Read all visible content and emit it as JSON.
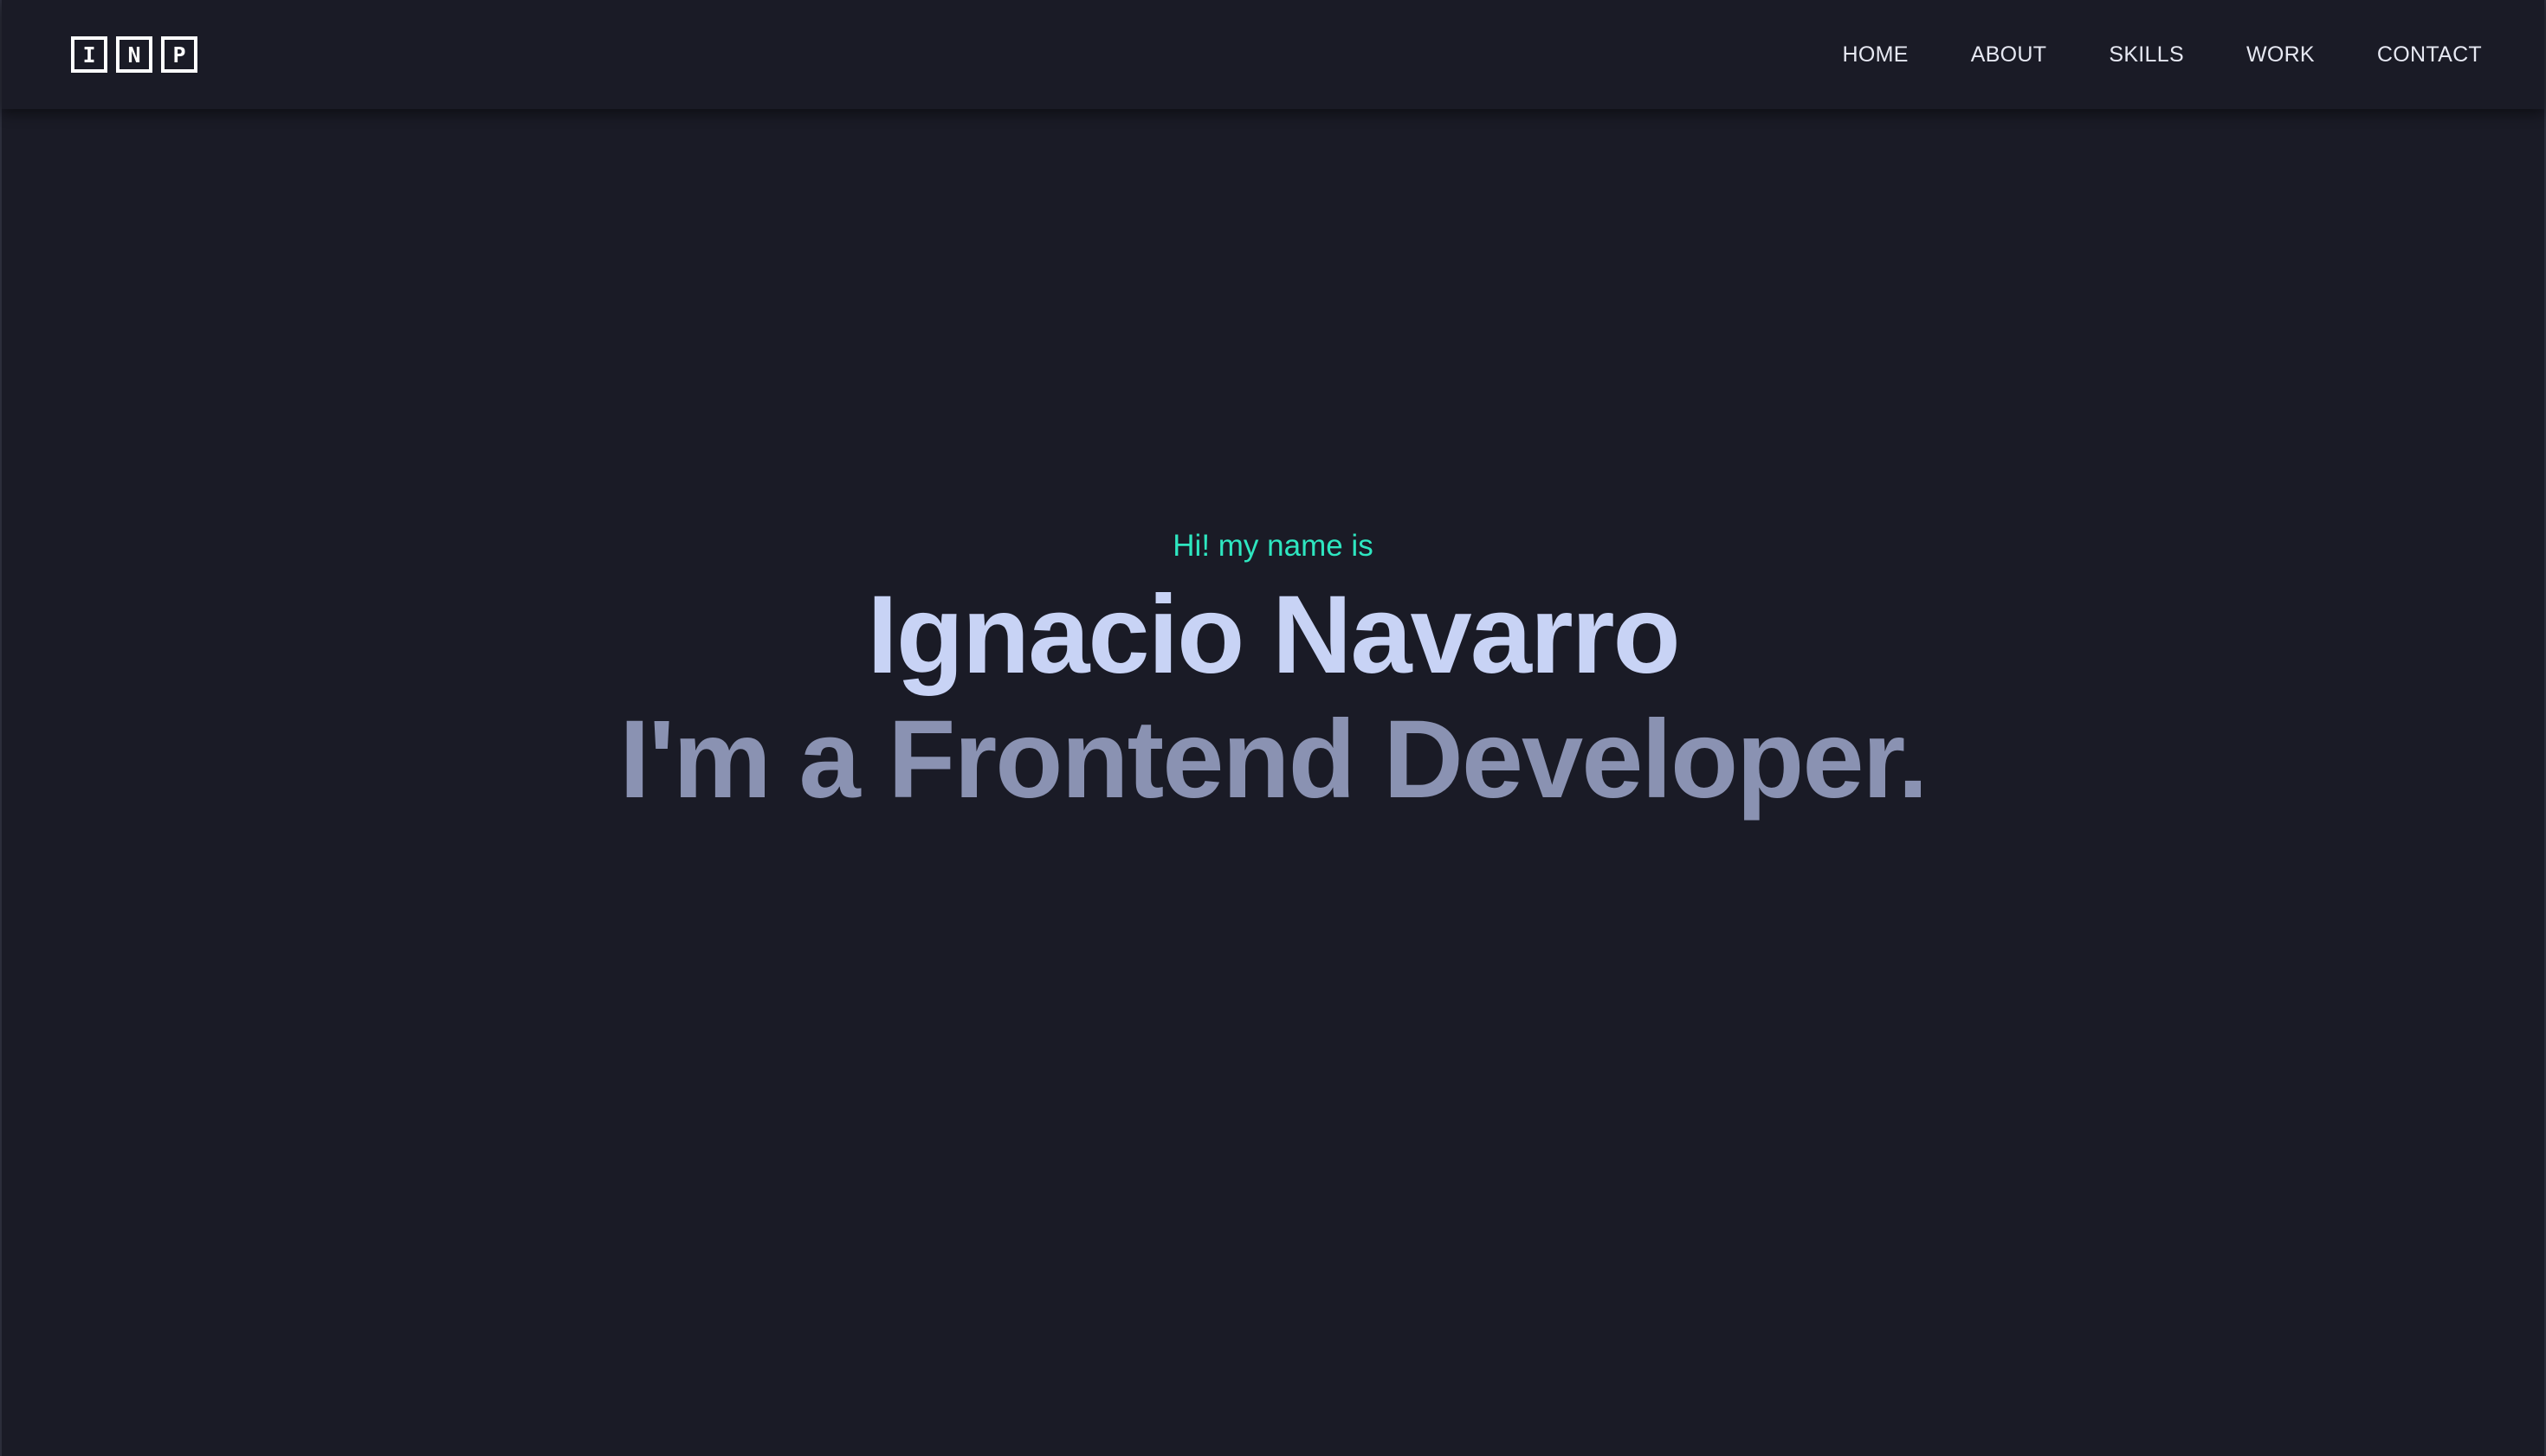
{
  "logo": {
    "letters": [
      "I",
      "N",
      "P"
    ]
  },
  "nav": {
    "items": [
      {
        "label": "HOME"
      },
      {
        "label": "ABOUT"
      },
      {
        "label": "SKILLS"
      },
      {
        "label": "WORK"
      },
      {
        "label": "CONTACT"
      }
    ]
  },
  "hero": {
    "greeting": "Hi! my name is",
    "name": "Ignacio Navarro",
    "role": "I'm a Frontend Developer."
  },
  "colors": {
    "background": "#1a1b26",
    "accent": "#2ee6c0",
    "name_text": "#c8d3f5",
    "role_text": "#8a92b2",
    "nav_text": "#e6e8f2"
  }
}
